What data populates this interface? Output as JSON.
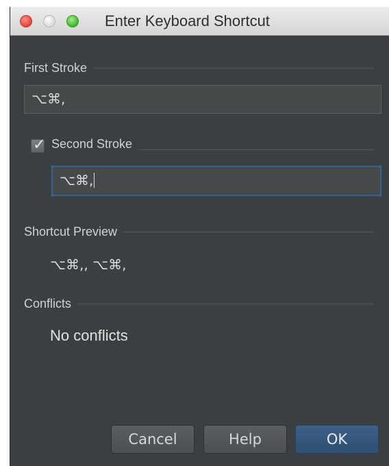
{
  "window": {
    "title": "Enter Keyboard Shortcut"
  },
  "first_stroke": {
    "label": "First Stroke",
    "value": "⌥⌘,"
  },
  "second_stroke": {
    "label": "Second Stroke",
    "checked": true,
    "value": "⌥⌘,"
  },
  "preview": {
    "label": "Shortcut Preview",
    "value": "⌥⌘,, ⌥⌘,"
  },
  "conflicts": {
    "label": "Conflicts",
    "value": "No conflicts"
  },
  "buttons": {
    "cancel": "Cancel",
    "help": "Help",
    "ok": "OK"
  },
  "icons": {
    "close": "close-icon",
    "minimize": "minimize-icon",
    "maximize": "maximize-icon",
    "checkmark": "checkmark-icon"
  }
}
